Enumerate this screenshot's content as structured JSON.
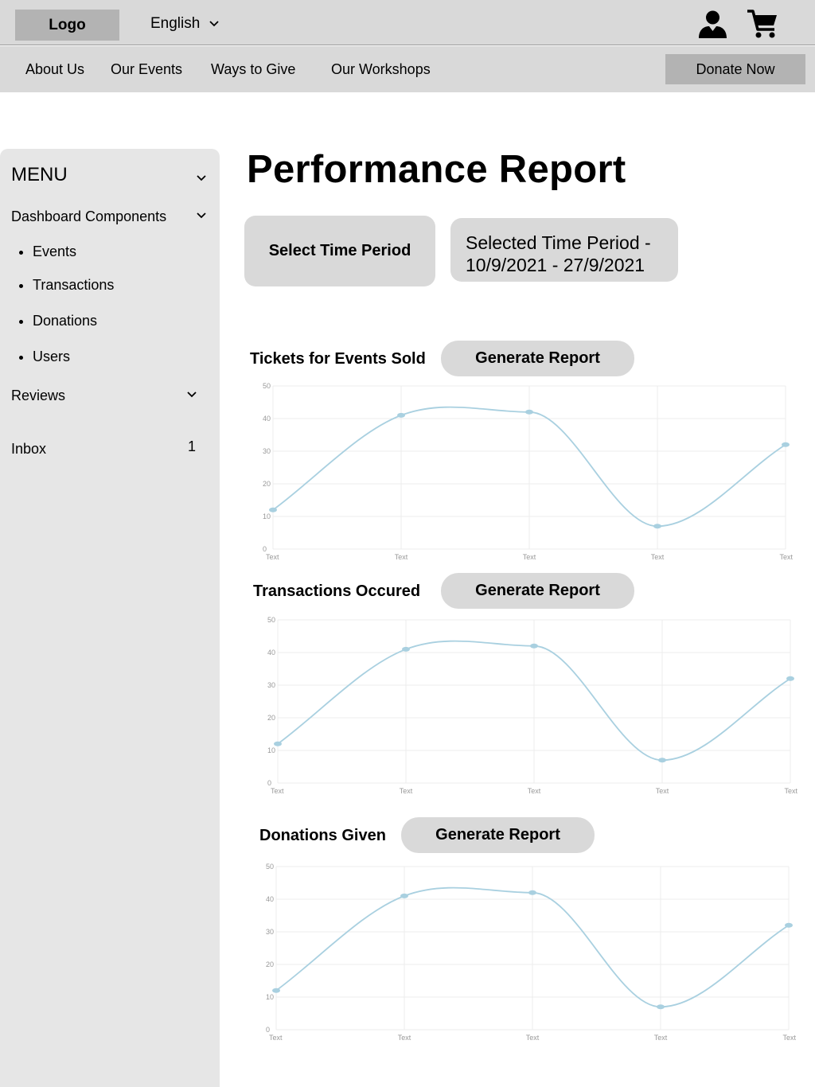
{
  "header": {
    "logo": "Logo",
    "language": "English",
    "user_icon": "user-icon",
    "cart_icon": "cart-icon"
  },
  "nav": {
    "items": [
      "About Us",
      "Our Events",
      "Ways to Give",
      "Our Workshops"
    ],
    "donate": "Donate Now"
  },
  "sidebar": {
    "title": "MENU",
    "section": "Dashboard Components",
    "items": [
      "Events",
      "Transactions",
      "Donations",
      "Users"
    ],
    "reviews": "Reviews",
    "inbox": "Inbox",
    "inbox_count": "1"
  },
  "main": {
    "title": "Performance Report",
    "select_period": "Select Time Period",
    "selected_period_line1": "Selected Time Period -",
    "selected_period_line2": "10/9/2021 - 27/9/2021",
    "generate_label": "Generate Report"
  },
  "chart_data": [
    {
      "type": "line",
      "title": "Tickets for Events Sold",
      "categories": [
        "Text",
        "Text",
        "Text",
        "Text",
        "Text"
      ],
      "values": [
        12,
        41,
        42,
        7,
        32
      ],
      "ylim": [
        0,
        50
      ],
      "yticks": [
        0,
        10,
        20,
        30,
        40,
        50
      ],
      "grid": true,
      "color": "#a9d0e0"
    },
    {
      "type": "line",
      "title": "Transactions Occured",
      "categories": [
        "Text",
        "Text",
        "Text",
        "Text",
        "Text"
      ],
      "values": [
        12,
        41,
        42,
        7,
        32
      ],
      "ylim": [
        0,
        50
      ],
      "yticks": [
        0,
        10,
        20,
        30,
        40,
        50
      ],
      "grid": true,
      "color": "#a9d0e0"
    },
    {
      "type": "line",
      "title": "Donations Given",
      "categories": [
        "Text",
        "Text",
        "Text",
        "Text",
        "Text"
      ],
      "values": [
        12,
        41,
        42,
        7,
        32
      ],
      "ylim": [
        0,
        50
      ],
      "yticks": [
        0,
        10,
        20,
        30,
        40,
        50
      ],
      "grid": true,
      "color": "#a9d0e0"
    }
  ]
}
